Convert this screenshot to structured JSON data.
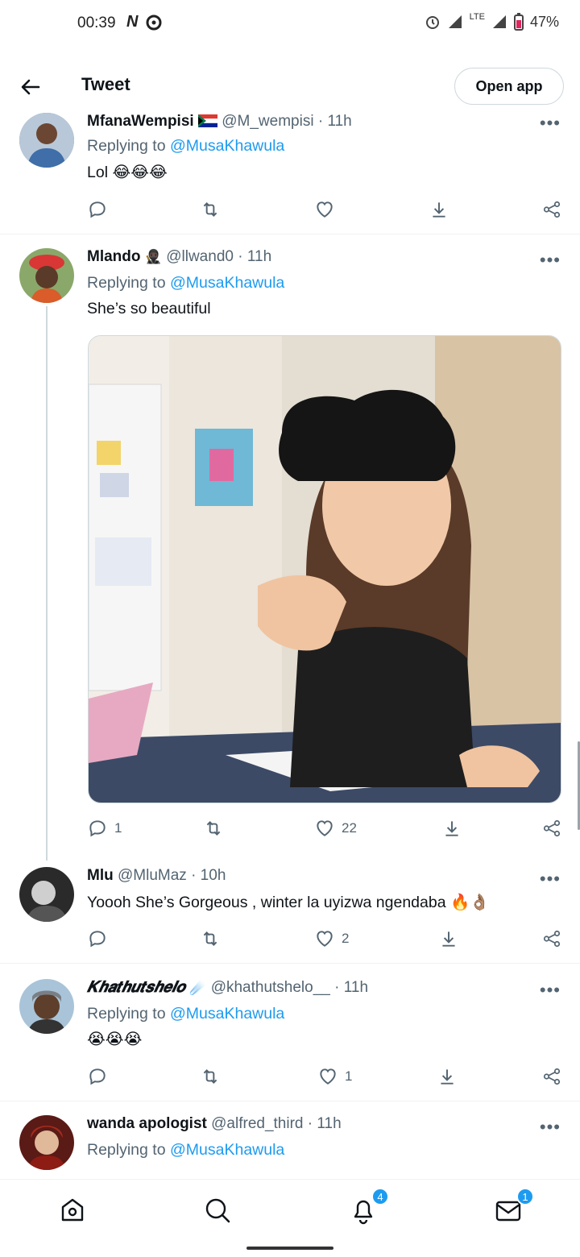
{
  "status_bar": {
    "time": "00:39",
    "network": "LTE",
    "battery": "47%"
  },
  "header": {
    "title": "Tweet",
    "open_app_label": "Open app"
  },
  "tweets": [
    {
      "name": "MfanaWempisi",
      "handle": "@M_wempisi",
      "time": "· 11h",
      "reply_prefix": "Replying to ",
      "reply_to": "@MusaKhawula",
      "text": "Lol 😂😂😂",
      "replies": "",
      "likes": ""
    },
    {
      "name": "Mlando",
      "handle": "@llwand0",
      "time": "· 11h",
      "reply_prefix": "Replying to ",
      "reply_to": "@MusaKhawula",
      "text": "She’s so beautiful",
      "replies": "1",
      "likes": "22"
    },
    {
      "name": "Mlu",
      "handle": "@MluMaz",
      "time": "· 10h",
      "text": "Yoooh She’s Gorgeous , winter la uyizwa ngendaba 🔥👌🏽",
      "replies": "",
      "likes": "2"
    },
    {
      "name": "𝑲𝒉𝒂𝒕𝒉𝒖𝒕𝒔𝒉𝒆𝒍𝒐",
      "handle": "@khathutshelo__",
      "time": "· 11h",
      "reply_prefix": "Replying to ",
      "reply_to": "@MusaKhawula",
      "text": "😭😭😭",
      "replies": "",
      "likes": "1"
    },
    {
      "name": "wanda apologist",
      "handle": "@alfred_third",
      "time": "· 11h",
      "reply_prefix": "Replying to ",
      "reply_to": "@MusaKhawula"
    }
  ],
  "bottom_nav": {
    "notifications_badge": "4",
    "messages_badge": "1"
  },
  "colors": {
    "accent": "#1d9bf0",
    "secondary_text": "#536471",
    "divider": "#eff3f4"
  }
}
